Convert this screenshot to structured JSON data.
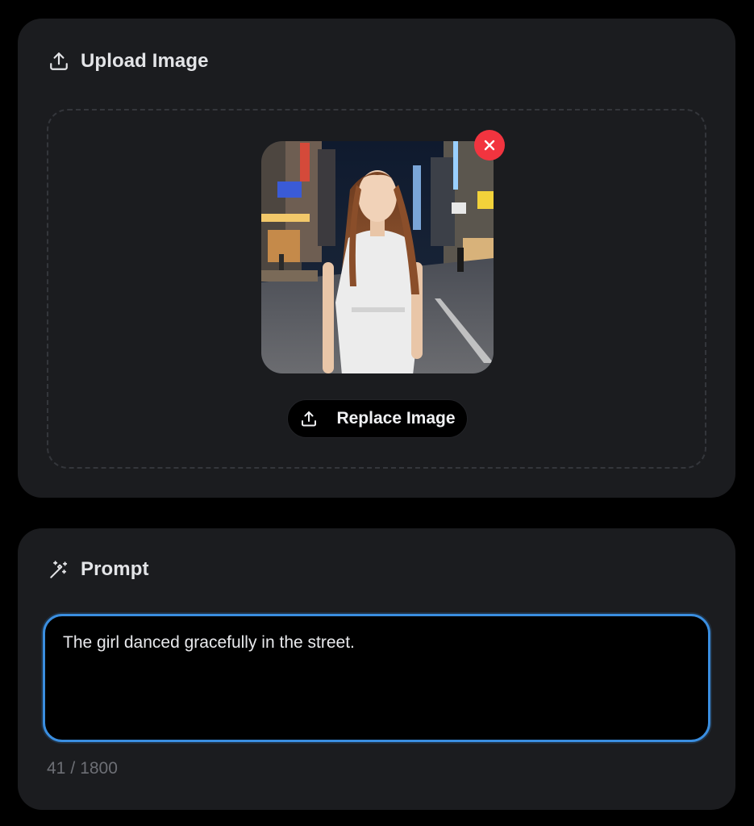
{
  "upload": {
    "title": "Upload Image",
    "header_icon": "upload-icon",
    "remove_icon": "close-icon",
    "replace_label": "Replace Image",
    "replace_icon": "upload-icon"
  },
  "prompt": {
    "title": "Prompt",
    "header_icon": "magic-wand-icon",
    "text": "The girl danced gracefully in the street.",
    "count": "41",
    "max": "1800"
  },
  "colors": {
    "background": "#000000",
    "card": "#1b1c1f",
    "focus_border": "#3a8ee0",
    "remove": "#f2343f"
  }
}
